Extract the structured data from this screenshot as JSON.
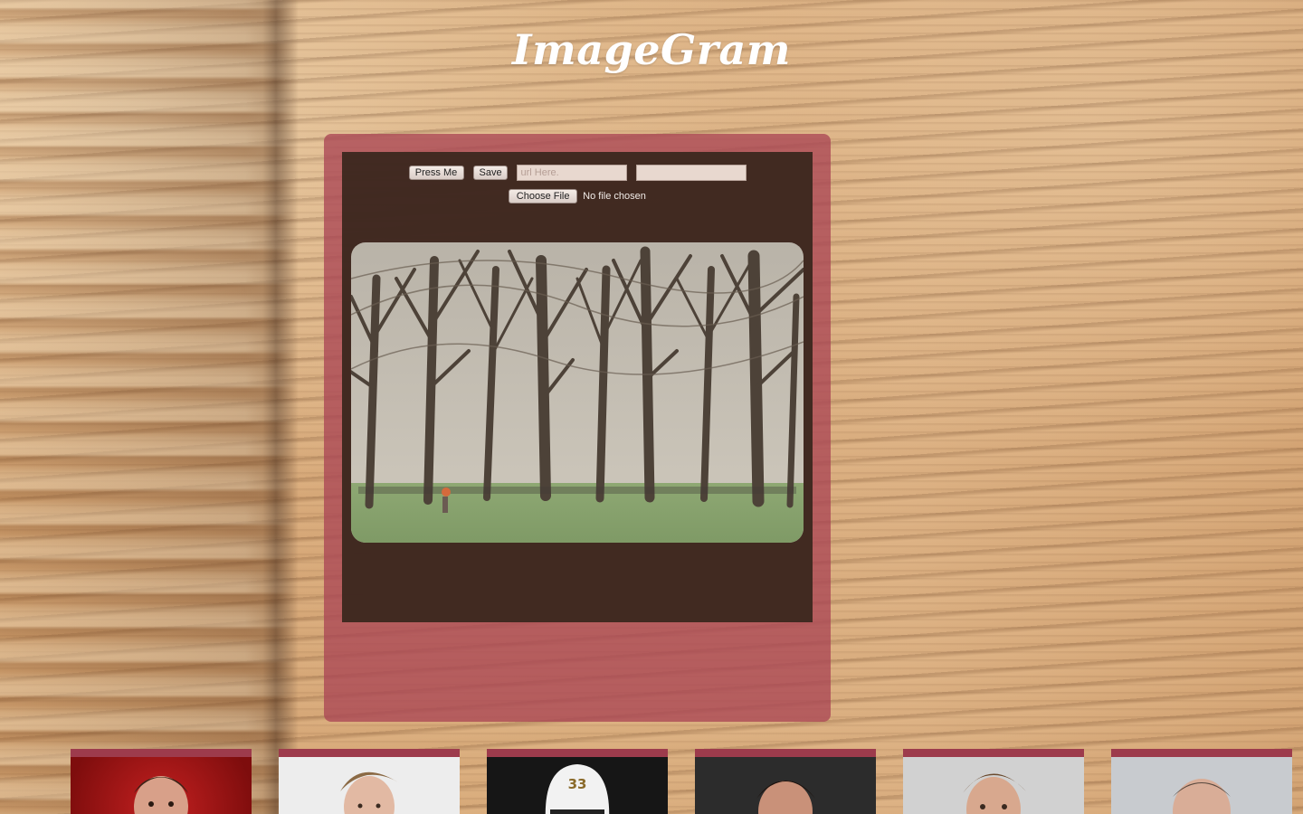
{
  "app": {
    "title": "ImageGram"
  },
  "controls": {
    "press_label": "Press Me",
    "save_label": "Save",
    "url_placeholder": "url Here.",
    "second_input_value": "",
    "choose_file_label": "Choose File",
    "file_status": "No file chosen"
  },
  "thumbnails": [
    {
      "name": "thumb-1",
      "bg": "#a81818"
    },
    {
      "name": "thumb-2",
      "bg": "#ececec"
    },
    {
      "name": "thumb-3",
      "bg": "#1a1a1a",
      "jersey_number": "33"
    },
    {
      "name": "thumb-4",
      "bg": "#2b2b2b"
    },
    {
      "name": "thumb-5",
      "bg": "#cfcfcf"
    },
    {
      "name": "thumb-6",
      "bg": "#c9ccd0"
    }
  ],
  "colors": {
    "frame": "#b0505f",
    "panel": "#3a281c",
    "thumb_border": "#9d3b4c"
  }
}
